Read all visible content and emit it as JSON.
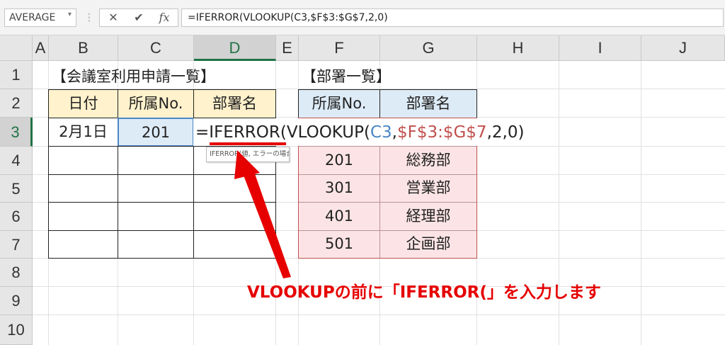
{
  "formula_bar": {
    "name_box": "AVERAGE",
    "name_box_dropdown_icon": "chevron-down-icon",
    "cancel_icon": "✕",
    "enter_icon": "✔",
    "fx_label": "fx",
    "formula_text": "=IFERROR(VLOOKUP(C3,$F$3:$G$7,2,0)"
  },
  "columns": [
    "A",
    "B",
    "C",
    "D",
    "E",
    "F",
    "G",
    "H",
    "I",
    "J"
  ],
  "rows": [
    "1",
    "2",
    "3",
    "4",
    "5",
    "6",
    "7",
    "8",
    "9",
    "10"
  ],
  "selected_column": "D",
  "selected_row": "3",
  "left_table": {
    "title": "【会議室利用申請一覧】",
    "headers": [
      "日付",
      "所属No.",
      "部署名"
    ],
    "row3": {
      "date": "2月1日",
      "dept_no": "201"
    }
  },
  "right_table": {
    "title": "【部署一覧】",
    "headers": [
      "所属No.",
      "部署名"
    ],
    "rows": [
      {
        "no": "201",
        "name": "総務部"
      },
      {
        "no": "301",
        "name": "営業部"
      },
      {
        "no": "401",
        "name": "経理部"
      },
      {
        "no": "501",
        "name": "企画部"
      }
    ]
  },
  "in_cell_formula": {
    "equals": "=",
    "iferror": "IFERROR",
    "open_paren": "(",
    "vlookup": "VLOOKUP(",
    "arg1": "C3",
    "comma1": ",",
    "arg2": "$F$3:$G$7",
    "rest": ",2,0)"
  },
  "tooltip": "IFERROR(値, エラーの場合の値)",
  "annotation": "VLOOKUPの前に「IFERROR(」を入力します",
  "colors": {
    "excel_green": "#217346",
    "annotation_red": "#e60000",
    "ref_blue": "#4a86c5",
    "ref_red": "#c0504d",
    "header_yellow": "#fff2cc",
    "header_blue": "#ddebf7",
    "range_pink": "#fce4e6"
  }
}
